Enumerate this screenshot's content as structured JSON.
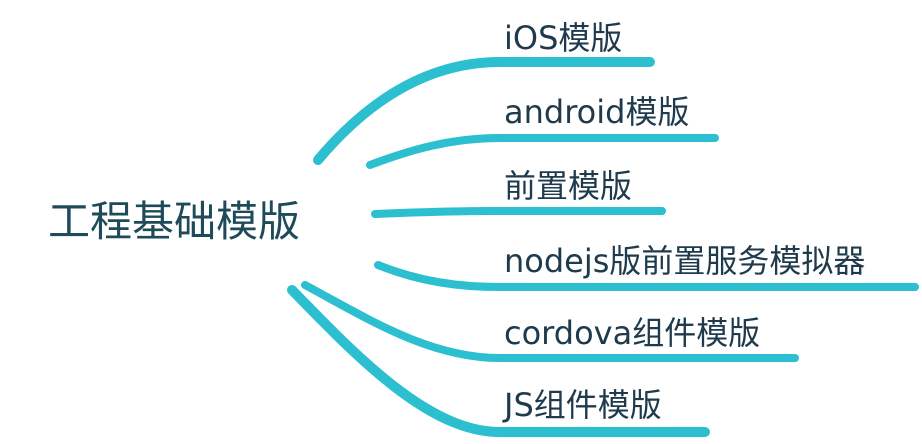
{
  "mindmap": {
    "root": {
      "label": "工程基础模版"
    },
    "branches": [
      {
        "label": "iOS模版"
      },
      {
        "label": "android模版"
      },
      {
        "label": "前置模版"
      },
      {
        "label": "nodejs版前置服务模拟器"
      },
      {
        "label": "cordova组件模版"
      },
      {
        "label": "JS组件模版"
      }
    ],
    "colors": {
      "connector": "#2bbfd0",
      "root_text": "#1e4a59",
      "branch_text": "#1e3a4c"
    }
  }
}
